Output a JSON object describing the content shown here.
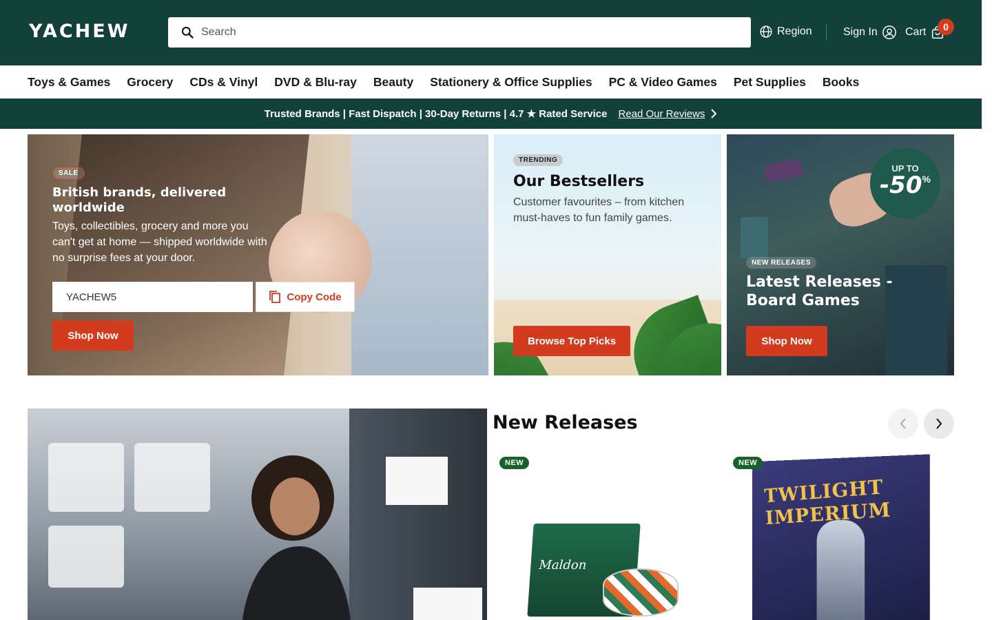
{
  "header": {
    "logo": "YACHEW",
    "search_placeholder": "Search",
    "region": "Region",
    "sign_in": "Sign In",
    "cart": "Cart",
    "cart_count": "0"
  },
  "nav": [
    "Toys & Games",
    "Grocery",
    "CDs & Vinyl",
    "DVD & Blu-ray",
    "Beauty",
    "Stationery & Office Supplies",
    "PC & Video Games",
    "Pet Supplies",
    "Books"
  ],
  "trust": {
    "text": "Trusted Brands | Fast Dispatch | 30-Day Returns | 4.7 ★ Rated Service",
    "link": "Read Our Reviews"
  },
  "hero_main": {
    "pill": "SALE",
    "title": "British brands, delivered worldwide",
    "body": "Toys, collectibles, grocery and more you can't get at home — shipped worldwide with no surprise fees at your door.",
    "code": "YACHEW5",
    "copy": "Copy Code",
    "cta": "Shop Now"
  },
  "hero_best": {
    "pill": "TRENDING",
    "title": "Our Bestsellers",
    "body": "Customer favourites – from kitchen must-haves to fun family games.",
    "cta": "Browse Top Picks"
  },
  "hero_games": {
    "up_to": "UP TO",
    "discount": "-50",
    "percent": "%",
    "pill": "NEW RELEASES",
    "title": "Latest Releases - Board Games",
    "cta": "Shop Now"
  },
  "new_releases": {
    "title": "New Releases",
    "products": [
      {
        "badge": "NEW",
        "brand": "Maldon"
      },
      {
        "badge": "NEW",
        "brand": "TWILIGHT IMPERIUM"
      }
    ]
  },
  "colors": {
    "brand": "#12413a",
    "accent": "#d23b1e",
    "new_badge": "#17612b"
  }
}
